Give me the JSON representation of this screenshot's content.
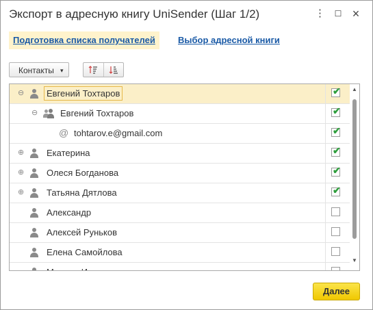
{
  "window": {
    "title": "Экспорт в адресную книгу UniSender (Шаг 1/2)",
    "menu_icon": "⋮",
    "maximize_icon": "☐",
    "close_icon": "×"
  },
  "steps": [
    {
      "label": "Подготовка списка получателей",
      "active": true
    },
    {
      "label": "Выбор адресной книги",
      "active": false
    }
  ],
  "toolbar": {
    "contacts_label": "Контакты",
    "contacts_arrow": "▾"
  },
  "tree": {
    "rows": [
      {
        "name": "Евгений Тохтаров",
        "icon": "person-icon",
        "expander": "⊖",
        "checked": true,
        "selected": true
      },
      {
        "name": "Евгений Тохтаров",
        "icon": "group-icon",
        "expander": "⊖",
        "checked": true
      },
      {
        "name": "tohtarov.e@gmail.com",
        "icon": "at-icon",
        "expander": "",
        "checked": true
      },
      {
        "name": "Екатерина",
        "icon": "person-icon",
        "expander": "⊕",
        "checked": true
      },
      {
        "name": "Олеся Богданова",
        "icon": "person-icon",
        "expander": "⊕",
        "checked": true
      },
      {
        "name": "Татьяна Дятлова",
        "icon": "person-icon",
        "expander": "⊕",
        "checked": true
      },
      {
        "name": "Александр",
        "icon": "person-icon",
        "expander": "",
        "checked": false
      },
      {
        "name": "Алексей Руньков",
        "icon": "person-icon",
        "expander": "",
        "checked": false
      },
      {
        "name": "Елена Самойлова",
        "icon": "person-icon",
        "expander": "",
        "checked": false
      },
      {
        "name": "Марина И...",
        "icon": "person-icon",
        "expander": "",
        "checked": false
      }
    ],
    "check_mark": "✔",
    "at_symbol": "@",
    "scroll_up": "▲",
    "scroll_down": "▼"
  },
  "footer": {
    "next_label": "Далее"
  },
  "colors": {
    "accent_link": "#1a5aa6",
    "active_step_bg": "#fff3cc",
    "selected_row_bg": "#fbefc8",
    "check_green": "#2e9e3c",
    "next_button": "#f5d11c"
  }
}
